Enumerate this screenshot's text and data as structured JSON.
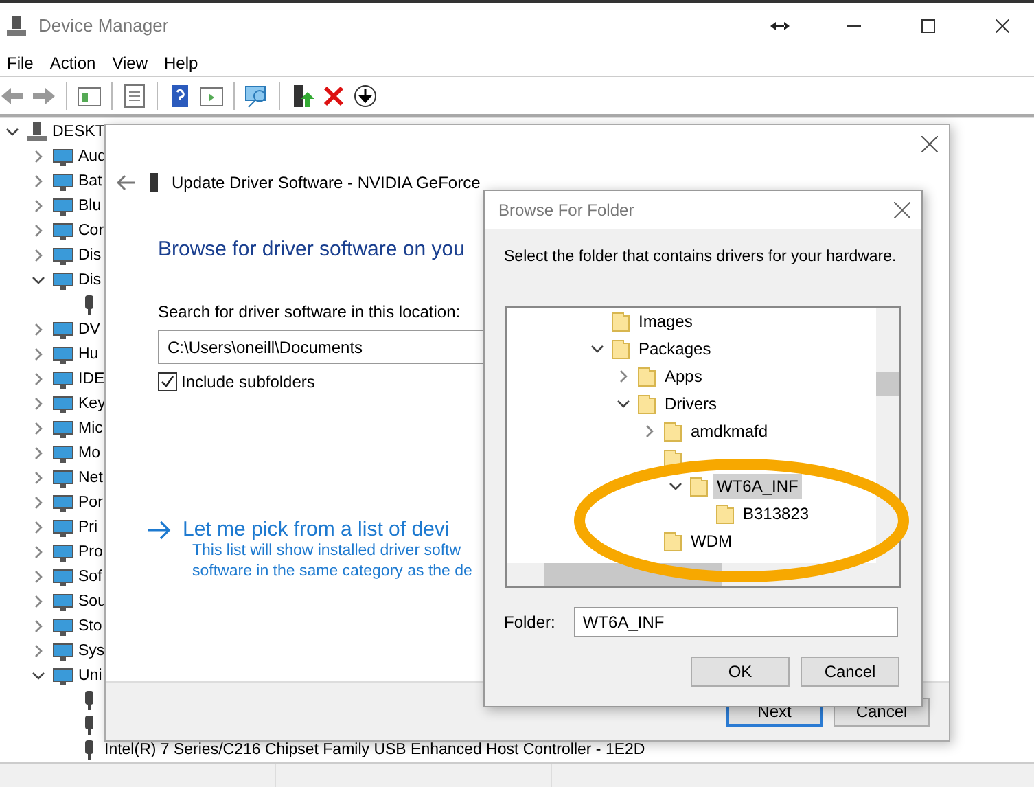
{
  "window": {
    "title": "Device Manager"
  },
  "menu": [
    "File",
    "Action",
    "View",
    "Help"
  ],
  "tree": [
    {
      "label": "DESKT",
      "kind": "computer",
      "expanded": true,
      "children": [
        {
          "label": "Aud",
          "kind": "category",
          "expanded": false
        },
        {
          "label": "Bat",
          "kind": "category",
          "expanded": false
        },
        {
          "label": "Blu",
          "kind": "category",
          "expanded": false
        },
        {
          "label": "Cor",
          "kind": "category",
          "expanded": false
        },
        {
          "label": "Dis",
          "kind": "category",
          "expanded": false
        },
        {
          "label": "Dis",
          "kind": "category",
          "expanded": true,
          "children": [
            {
              "kind": "device"
            }
          ]
        },
        {
          "label": "DV",
          "kind": "category",
          "expanded": false
        },
        {
          "label": "Hu",
          "kind": "category",
          "expanded": false
        },
        {
          "label": "IDE",
          "kind": "category",
          "expanded": false
        },
        {
          "label": "Key",
          "kind": "category",
          "expanded": false
        },
        {
          "label": "Mic",
          "kind": "category",
          "expanded": false
        },
        {
          "label": "Mo",
          "kind": "category",
          "expanded": false
        },
        {
          "label": "Net",
          "kind": "category",
          "expanded": false
        },
        {
          "label": "Por",
          "kind": "category",
          "expanded": false
        },
        {
          "label": "Pri",
          "kind": "category",
          "expanded": false
        },
        {
          "label": "Pro",
          "kind": "category",
          "expanded": false
        },
        {
          "label": "Sof",
          "kind": "category",
          "expanded": false
        },
        {
          "label": "Sou",
          "kind": "category",
          "expanded": false
        },
        {
          "label": "Sto",
          "kind": "category",
          "expanded": false
        },
        {
          "label": "Sys",
          "kind": "category",
          "expanded": false
        },
        {
          "label": "Uni",
          "kind": "category",
          "expanded": true,
          "children": [
            {
              "kind": "device"
            },
            {
              "kind": "device"
            },
            {
              "kind": "device",
              "label": "Intel(R) 7 Series/C216 Chipset Family USB Enhanced Host Controller - 1E2D"
            }
          ]
        }
      ]
    }
  ],
  "update_dialog": {
    "title": "Update Driver Software - NVIDIA GeForce",
    "heading": "Browse for driver software on you",
    "search_label": "Search for driver software in this location:",
    "path": "C:\\Users\\oneill\\Documents",
    "include_subfolders": {
      "label": "Include subfolders",
      "checked": true
    },
    "pick_link": "Let me pick from a list of devi",
    "pick_description": [
      "This list will show installed driver softw",
      "software in the same category as the de"
    ],
    "buttons": [
      {
        "label": "Next",
        "default": true
      },
      {
        "label": "Cancel",
        "default": false
      }
    ]
  },
  "browse_dialog": {
    "title": "Browse For Folder",
    "instruction": "Select the folder that contains drivers for your hardware.",
    "folders": [
      {
        "label": "Images",
        "kind": "leaf",
        "selected": false
      },
      {
        "label": "Packages",
        "kind": "branch",
        "expanded": true,
        "selected": false,
        "children": [
          {
            "label": "Apps",
            "kind": "branch",
            "expanded": false,
            "selected": false
          },
          {
            "label": "Drivers",
            "kind": "branch",
            "expanded": true,
            "selected": false,
            "children": [
              {
                "label": "amdkmafd",
                "kind": "branch",
                "expanded": false,
                "selected": false
              },
              {
                "kind": "hidden",
                "selected": false,
                "children": [
                  {
                    "label": "WT6A_INF",
                    "kind": "branch",
                    "expanded": true,
                    "selected": true,
                    "children": [
                      {
                        "label": "B313823",
                        "kind": "leaf",
                        "selected": false
                      }
                    ]
                  }
                ]
              },
              {
                "label": "WDM",
                "kind": "leaf",
                "selected": false
              }
            ]
          }
        ]
      }
    ],
    "folder_field": {
      "label": "Folder:",
      "value": "WT6A_INF"
    },
    "buttons": [
      {
        "label": "OK",
        "default": false
      },
      {
        "label": "Cancel",
        "default": false
      }
    ]
  }
}
